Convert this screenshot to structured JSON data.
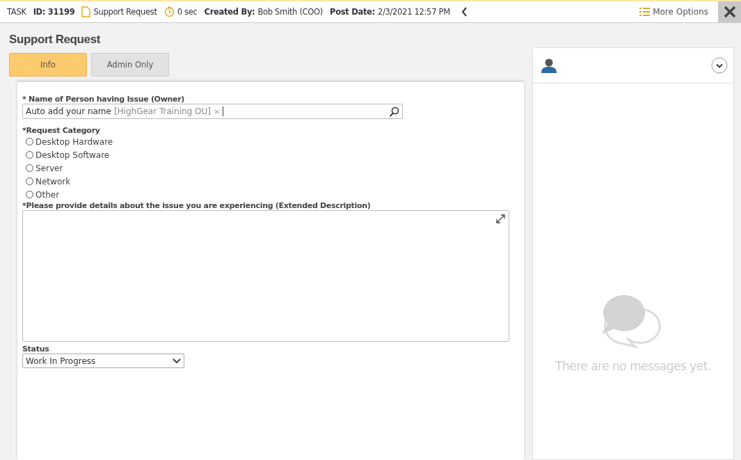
{
  "task_bar": {
    "task_label": "TASK",
    "meta": [
      {
        "kind": "id",
        "label": "ID:",
        "value": "31199"
      },
      {
        "kind": "type",
        "value": "Support Request"
      },
      {
        "kind": "timer",
        "value": "0 sec"
      },
      {
        "kind": "field",
        "label": "Created By:",
        "value": "Bob Smith (COO)"
      },
      {
        "kind": "field",
        "label": "Post Date:",
        "value": "2/3/2021 12:57 PM"
      }
    ],
    "more_options": "More Options"
  },
  "title": "Support Request",
  "tabs": [
    {
      "label": "Info",
      "selected": true
    },
    {
      "label": "Admin Only",
      "selected": false
    }
  ],
  "form": {
    "owner": {
      "label": "* Name of Person having Issue (Owner)",
      "value": "Auto add your name",
      "token": "[HighGear Training OU]",
      "token_remove": "×"
    },
    "category": {
      "label": "*Request Category",
      "options": [
        {
          "label": "Desktop Hardware",
          "selected": false
        },
        {
          "label": "Desktop Software",
          "selected": false
        },
        {
          "label": "Server",
          "selected": false
        },
        {
          "label": "Network",
          "selected": false
        },
        {
          "label": "Other",
          "selected": false
        }
      ]
    },
    "description": {
      "label": "*Please provide details about the issue you are experiencing (Extended Description)"
    },
    "status": {
      "label": "Status",
      "value": "Work In Progress"
    }
  },
  "messages": {
    "empty_text": "There are no messages yet."
  }
}
